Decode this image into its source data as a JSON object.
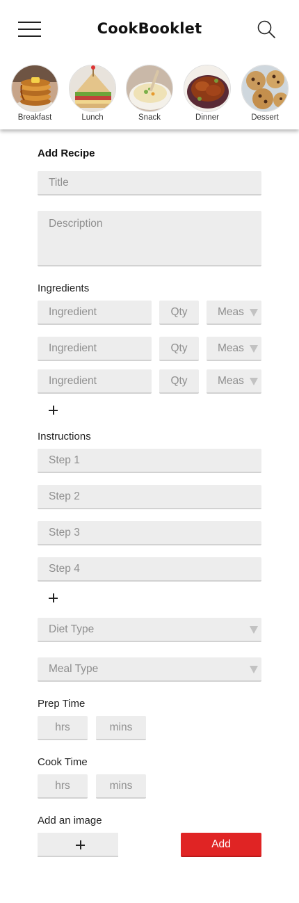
{
  "header": {
    "title": "CookBooklet",
    "menu_icon": "hamburger-menu-icon",
    "search_icon": "magnifier-search-icon"
  },
  "categories": [
    {
      "label": "Breakfast",
      "image": "pancake-stack-photo"
    },
    {
      "label": "Lunch",
      "image": "sandwich-photo"
    },
    {
      "label": "Snack",
      "image": "soup-bowl-photo"
    },
    {
      "label": "Dinner",
      "image": "roast-chicken-photo"
    },
    {
      "label": "Dessert",
      "image": "cookies-photo"
    }
  ],
  "form": {
    "heading": "Add Recipe",
    "title_placeholder": "Title",
    "description_placeholder": "Description",
    "ingredients_label": "Ingredients",
    "ingredient_rows": [
      {
        "ingredient_placeholder": "Ingredient",
        "qty_placeholder": "Qty",
        "measure_placeholder": "Meas"
      },
      {
        "ingredient_placeholder": "Ingredient",
        "qty_placeholder": "Qty",
        "measure_placeholder": "Meas"
      },
      {
        "ingredient_placeholder": "Ingredient",
        "qty_placeholder": "Qty",
        "measure_placeholder": "Meas"
      }
    ],
    "instructions_label": "Instructions",
    "steps": [
      {
        "placeholder": "Step 1"
      },
      {
        "placeholder": "Step 2"
      },
      {
        "placeholder": "Step 3"
      },
      {
        "placeholder": "Step 4"
      }
    ],
    "diet_type_placeholder": "Diet Type",
    "meal_type_placeholder": "Meal Type",
    "prep_time_label": "Prep Time",
    "prep_hrs_placeholder": "hrs",
    "prep_mins_placeholder": "mins",
    "cook_time_label": "Cook Time",
    "cook_hrs_placeholder": "hrs",
    "cook_mins_placeholder": "mins",
    "image_label": "Add an image",
    "submit_label": "Add"
  },
  "colors": {
    "accent": "#e02424",
    "field_bg": "#ededed",
    "placeholder": "#8f8f8f"
  }
}
